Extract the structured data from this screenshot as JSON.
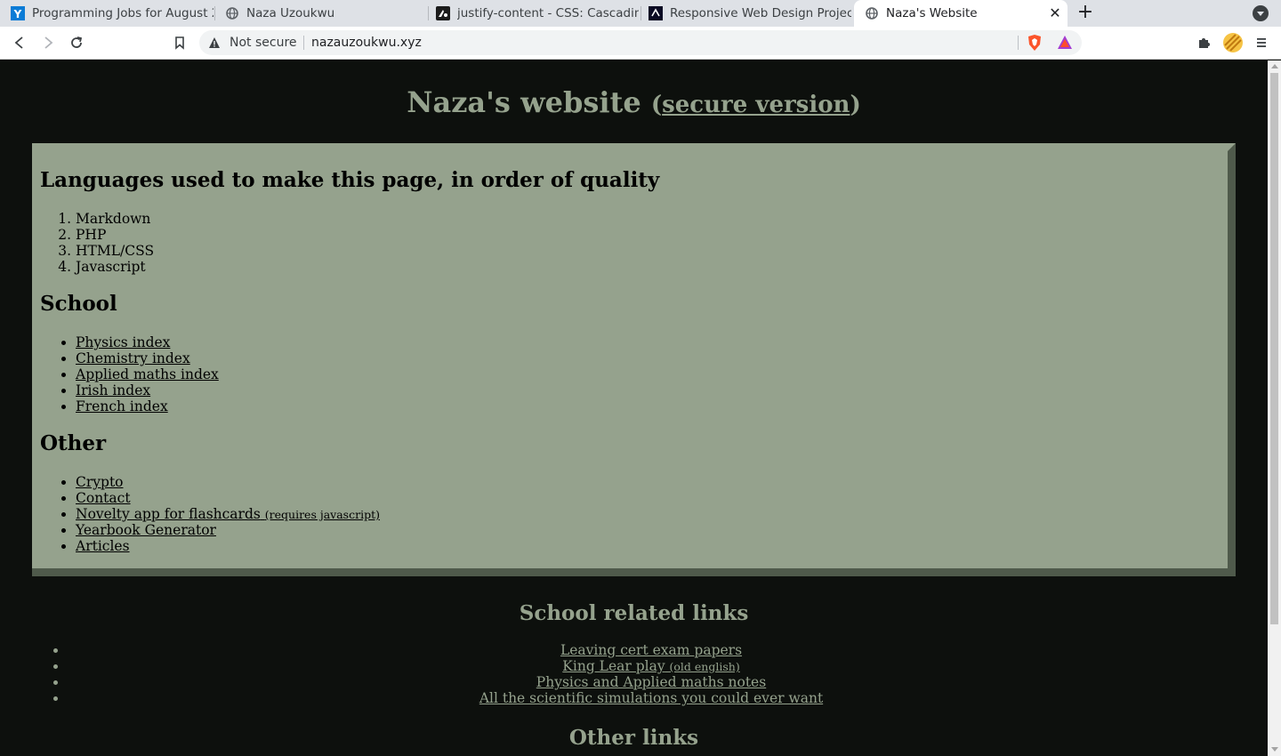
{
  "browser": {
    "tabs": [
      {
        "title": "Programming Jobs for August 2",
        "icon": "yc-icon"
      },
      {
        "title": "Naza Uzoukwu",
        "icon": "globe-icon"
      },
      {
        "title": "justify-content - CSS: Cascading",
        "icon": "mdn-icon"
      },
      {
        "title": "Responsive Web Design Projec",
        "icon": "freecodecamp-icon"
      },
      {
        "title": "Naza's Website",
        "icon": "globe-icon",
        "active": true
      }
    ],
    "security_label": "Not secure",
    "url": "nazauzoukwu.xyz"
  },
  "page": {
    "title": "Naza's website",
    "title_paren_open": "(",
    "secure_link": "secure version",
    "title_paren_close": ")",
    "colors": {
      "background": "#0d100d",
      "accent": "#95a28d",
      "box_shadow": "#4f5a4b"
    },
    "languages": {
      "heading": "Languages used to make this page, in order of quality",
      "items": [
        "Markdown",
        "PHP",
        "HTML/CSS",
        "Javascript"
      ]
    },
    "school": {
      "heading": "School",
      "items": [
        "Physics index",
        "Chemistry index",
        "Applied maths index",
        "Irish index",
        "French index"
      ]
    },
    "other": {
      "heading": "Other",
      "items": [
        {
          "label": "Crypto"
        },
        {
          "label": "Contact"
        },
        {
          "label": "Novelty app for flashcards",
          "note": "(requires javascript)"
        },
        {
          "label": "Yearbook Generator"
        },
        {
          "label": "Articles"
        }
      ]
    },
    "school_related": {
      "heading": "School related links",
      "items": [
        {
          "label": "Leaving cert exam papers"
        },
        {
          "label": "King Lear play",
          "note": "(old english)"
        },
        {
          "label": "Physics and Applied maths notes"
        },
        {
          "label": "All the scientific simulations you could ever want"
        }
      ]
    },
    "other_links": {
      "heading": "Other links"
    }
  }
}
